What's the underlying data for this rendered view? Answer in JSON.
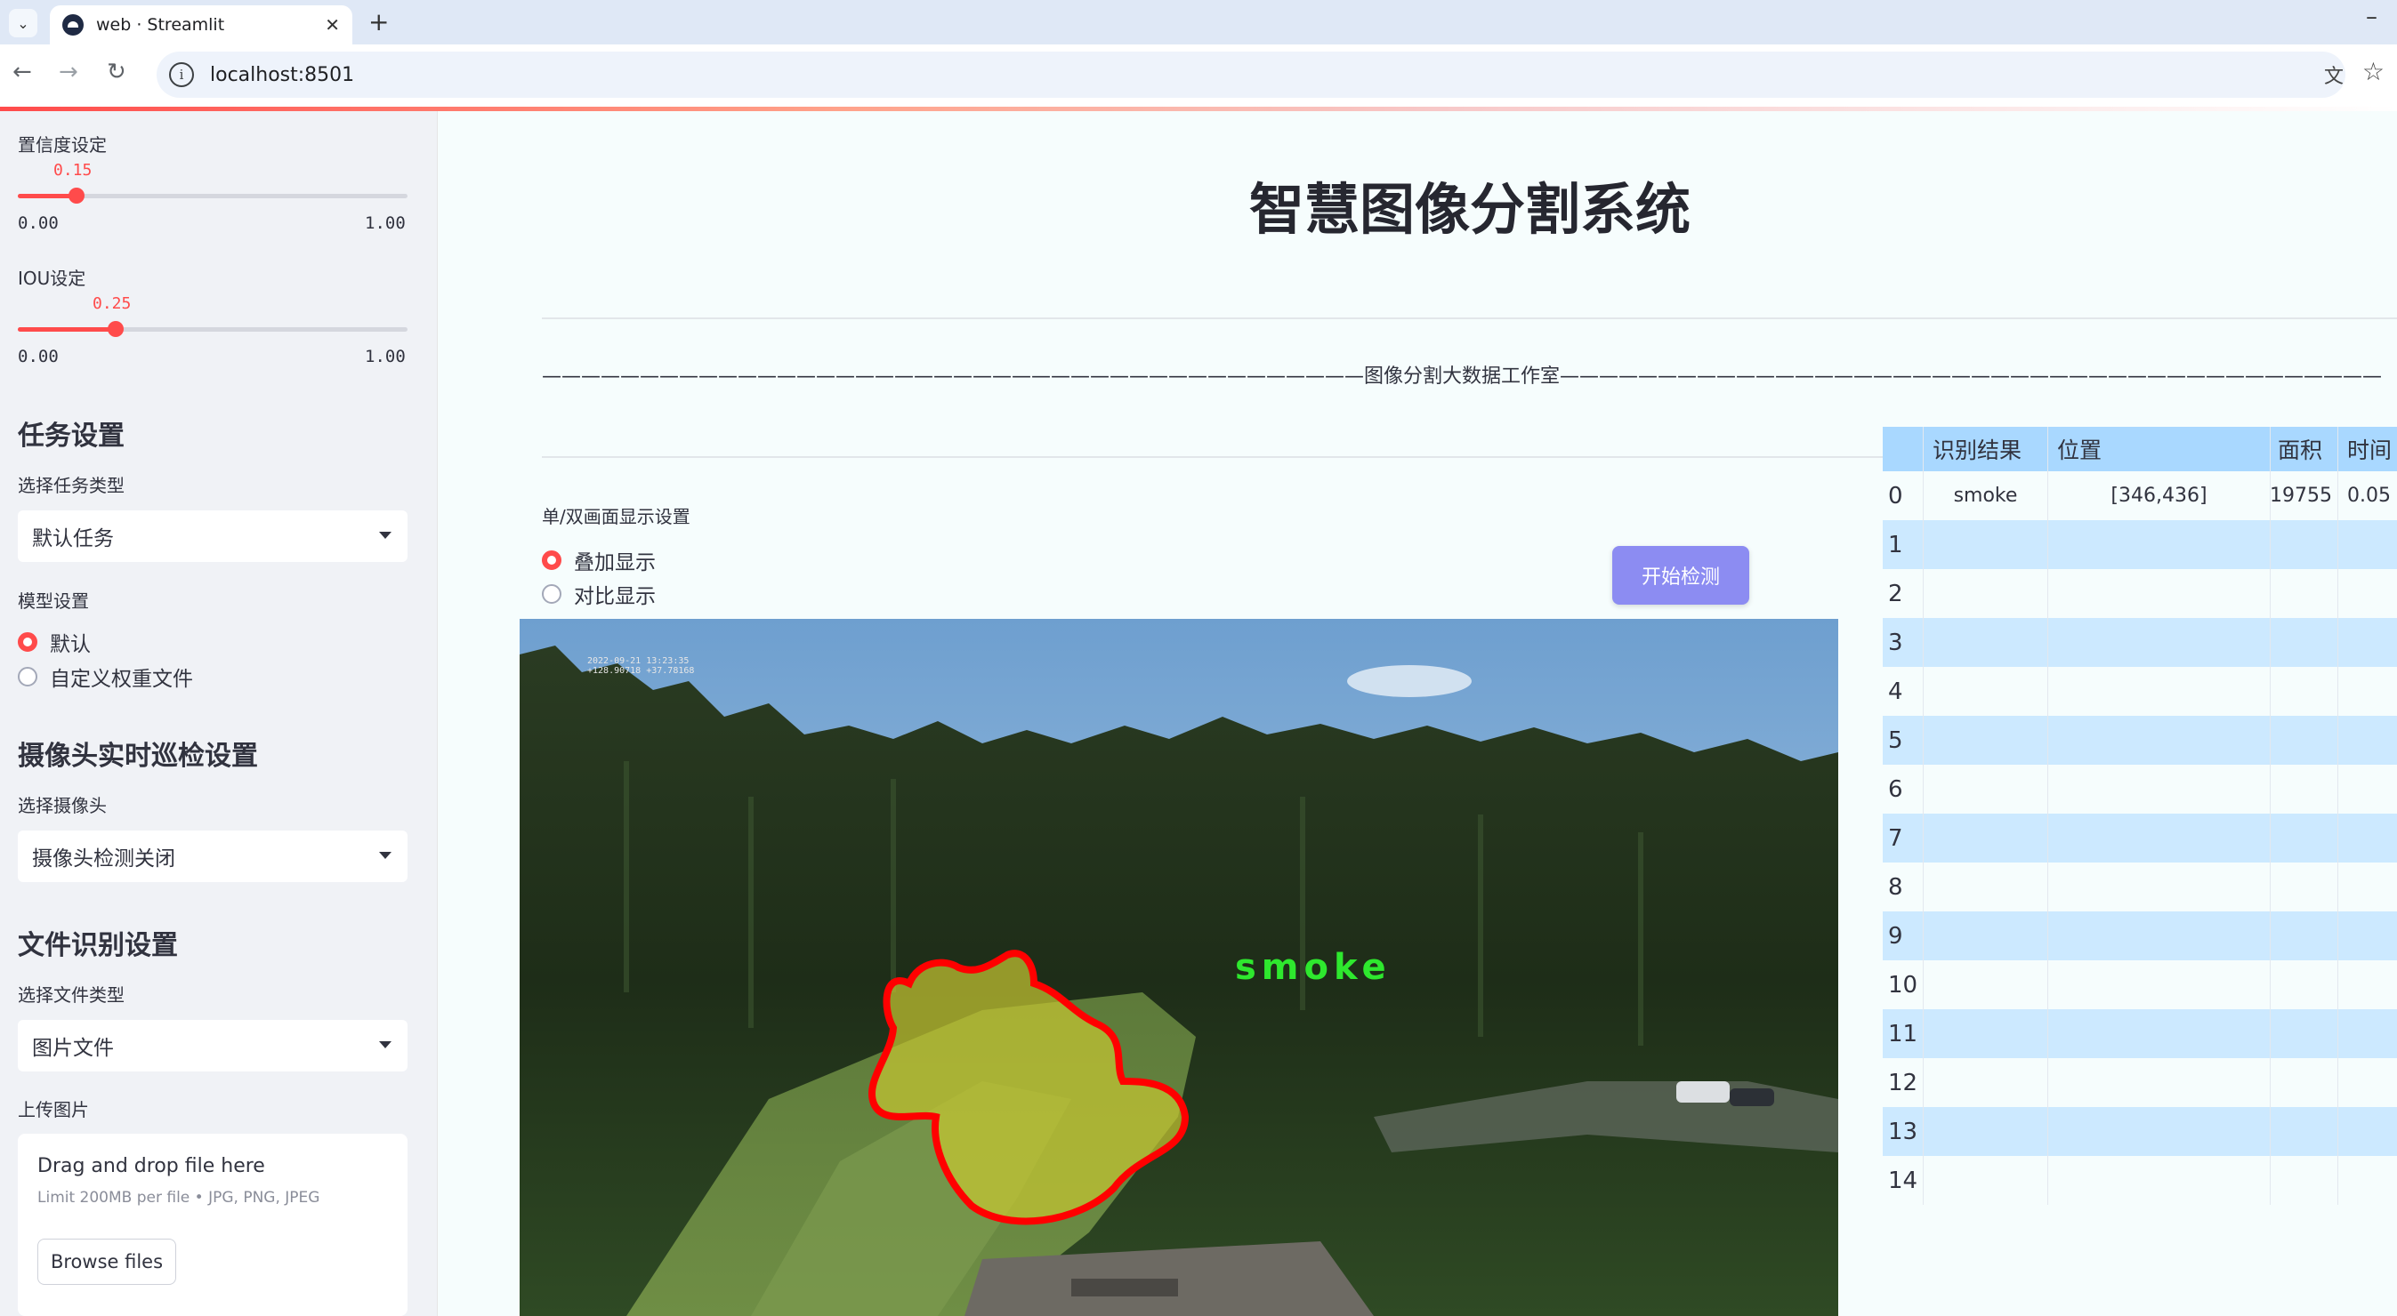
{
  "browser": {
    "tab_title": "web · Streamlit",
    "url": "localhost:8501"
  },
  "sidebar": {
    "confidence": {
      "label": "置信度设定",
      "value": "0.15",
      "value_fraction": 0.15,
      "min": "0.00",
      "max": "1.00"
    },
    "iou": {
      "label": "IOU设定",
      "value": "0.25",
      "value_fraction": 0.25,
      "min": "0.00",
      "max": "1.00"
    },
    "task_header": "任务设置",
    "task_type_label": "选择任务类型",
    "task_type_value": "默认任务",
    "model_label": "模型设置",
    "model_options": [
      "默认",
      "自定义权重文件"
    ],
    "model_selected": "默认",
    "camera_header": "摄像头实时巡检设置",
    "camera_label": "选择摄像头",
    "camera_value": "摄像头检测关闭",
    "file_header": "文件识别设置",
    "file_type_label": "选择文件类型",
    "file_type_value": "图片文件",
    "upload_label": "上传图片",
    "upload_drop": "Drag and drop file here",
    "upload_limit": "Limit 200MB per file • JPG, PNG, JPEG",
    "upload_button": "Browse files"
  },
  "main": {
    "title": "智慧图像分割系统",
    "divider_text": "——————————————————————————————————————————图像分割大数据工作室——————————————————————————————————————————",
    "display_label": "单/双画面显示设置",
    "display_options": [
      "叠加显示",
      "对比显示"
    ],
    "display_selected": "叠加显示",
    "start_button": "开始检测",
    "camera_stamp_line1": "2022-09-21 13:23:35",
    "camera_stamp_line2": "+128.90718 +37.78168",
    "detection_label": "smoke",
    "overlay_colors": {
      "mask_fill": "#c8c832",
      "mask_outline": "#ff0000",
      "label": "#2ee82e"
    }
  },
  "table": {
    "columns": [
      "识别结果",
      "位置",
      "面积",
      "时间"
    ],
    "rows": [
      {
        "idx": "0",
        "result": "smoke",
        "position": "[346,436]",
        "area": "19755",
        "time": "0.05"
      },
      {
        "idx": "1"
      },
      {
        "idx": "2"
      },
      {
        "idx": "3"
      },
      {
        "idx": "4"
      },
      {
        "idx": "5"
      },
      {
        "idx": "6"
      },
      {
        "idx": "7"
      },
      {
        "idx": "8"
      },
      {
        "idx": "9"
      },
      {
        "idx": "10"
      },
      {
        "idx": "11"
      },
      {
        "idx": "12"
      },
      {
        "idx": "13"
      },
      {
        "idx": "14"
      }
    ]
  },
  "colors": {
    "accent": "#ff4b4b",
    "button": "#8c8cf2",
    "table_header": "#a9d8ff",
    "table_band": "#cce9ff"
  }
}
